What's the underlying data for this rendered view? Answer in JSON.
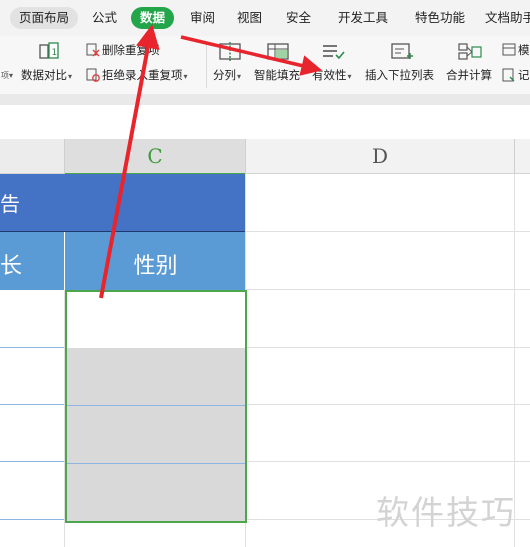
{
  "ribbon_tabs": [
    "页面布局",
    "公式",
    "数据",
    "审阅",
    "视图",
    "安全",
    "开发工具",
    "特色功能",
    "文档助手"
  ],
  "active_tab": "数据",
  "toolbar": {
    "delete_duplicates": "删除重复项",
    "reject_duplicates": "拒绝录入重复项",
    "data_compare": "数据对比",
    "split": "分列",
    "smart_fill": "智能填充",
    "validity": "有效性",
    "insert_dropdown": "插入下拉列表",
    "merge_calc": "合并计算",
    "simulate": "模",
    "record": "记"
  },
  "columns": {
    "c": "C",
    "d": "D"
  },
  "table": {
    "header_fragment": "告",
    "col_b_header": "长",
    "col_c_header": "性别"
  },
  "watermark": "软件技巧",
  "colors": {
    "active_tab": "#23a54a",
    "header_dark": "#4472c4",
    "header_light": "#5b9bd5",
    "selection_border": "#4ca64c",
    "cell_fill": "#d9d9d9",
    "arrow": "#e8242c"
  }
}
